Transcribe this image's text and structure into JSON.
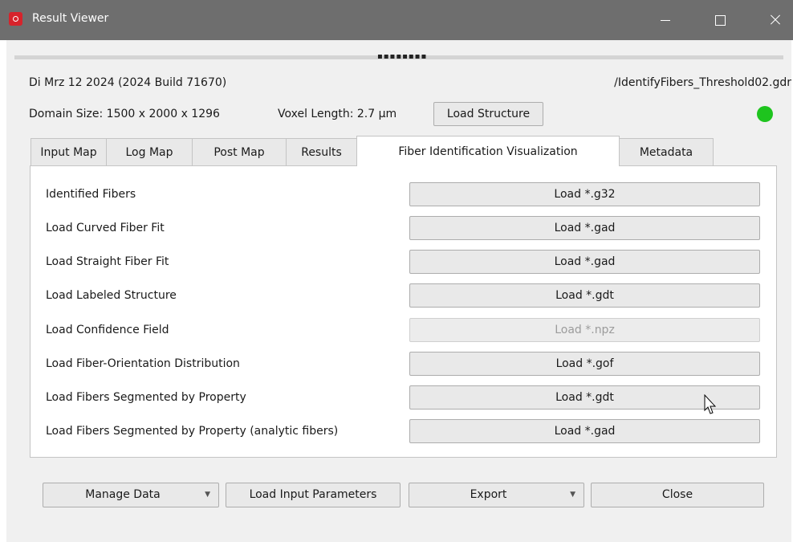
{
  "titlebar": {
    "title": "Result Viewer"
  },
  "header": {
    "version": "Di Mrz 12 2024 (2024 Build 71670)",
    "file_path": "/IdentifyFibers_Threshold02.gdr",
    "domain_size": "Domain Size: 1500 x 2000 x 1296",
    "voxel_length": "Voxel Length: 2.7 µm",
    "load_structure_label": "Load Structure",
    "status_color": "#1ec41e"
  },
  "tabs": [
    {
      "label": "Input Map"
    },
    {
      "label": "Log Map"
    },
    {
      "label": "Post Map"
    },
    {
      "label": "Results"
    },
    {
      "label": "Fiber Identification Visualization"
    },
    {
      "label": "Metadata"
    }
  ],
  "active_tab": "Fiber Identification Visualization",
  "rows": [
    {
      "label": "Identified Fibers",
      "button": "Load *.g32",
      "enabled": true
    },
    {
      "label": "Load Curved Fiber Fit",
      "button": "Load *.gad",
      "enabled": true
    },
    {
      "label": "Load Straight Fiber Fit",
      "button": "Load *.gad",
      "enabled": true
    },
    {
      "label": "Load Labeled Structure",
      "button": "Load *.gdt",
      "enabled": true
    },
    {
      "label": "Load Confidence Field",
      "button": "Load *.npz",
      "enabled": false
    },
    {
      "label": "Load Fiber-Orientation Distribution",
      "button": "Load *.gof",
      "enabled": true
    },
    {
      "label": "Load Fibers Segmented by Property",
      "button": "Load *.gdt",
      "enabled": true
    },
    {
      "label": "Load Fibers Segmented by Property (analytic fibers)",
      "button": "Load *.gad",
      "enabled": true
    }
  ],
  "footer": {
    "manage_data": "Manage Data",
    "load_input_parameters": "Load Input Parameters",
    "export": "Export",
    "close": "Close"
  }
}
